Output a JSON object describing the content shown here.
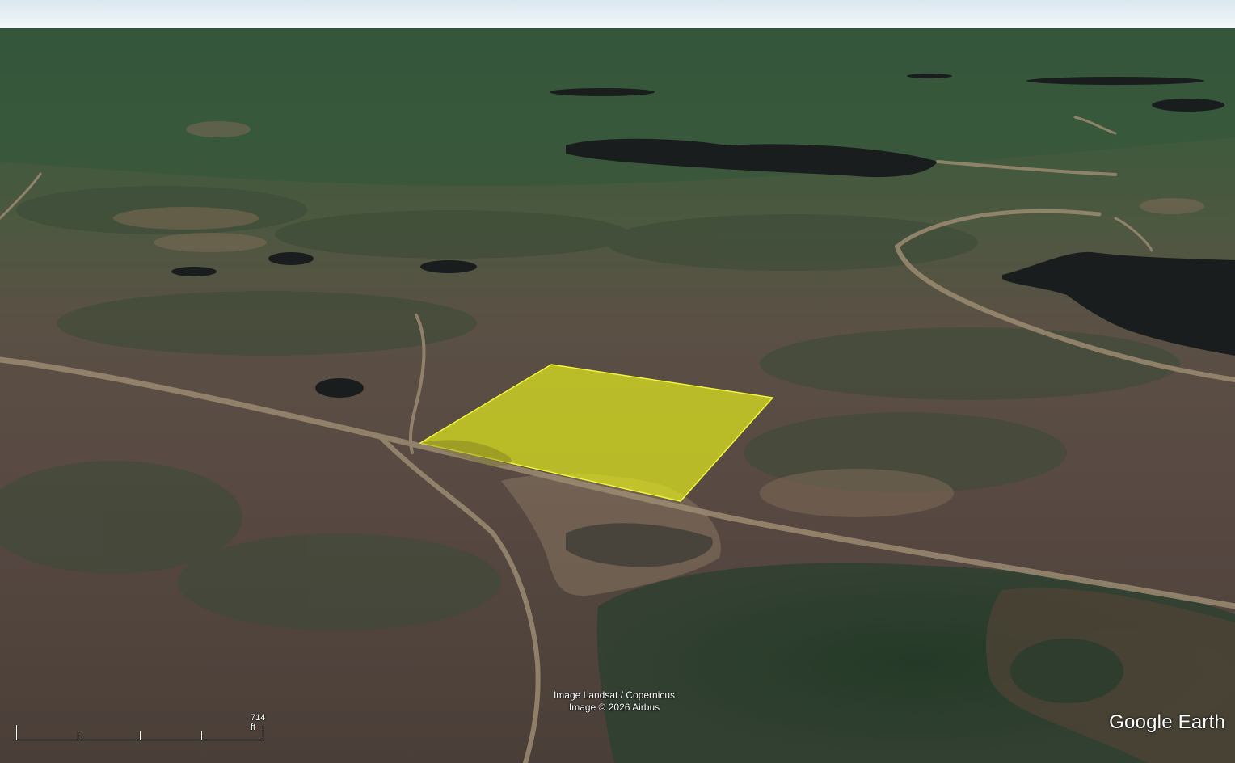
{
  "attribution": {
    "line1": "Image Landsat / Copernicus",
    "line2": "Image © 2026 Airbus"
  },
  "scale": {
    "label": "714 ft"
  },
  "logo": {
    "text": "Google Earth"
  },
  "colors": {
    "sky_top": "#dbe9f1",
    "sky_bottom": "#f4f8fa",
    "far_terrain": "#3c5a3b",
    "near_terrain": "#4e4237",
    "water": "#1a1d1f",
    "parcel_fill": "#e8f01a",
    "parcel_stroke": "#f5f540"
  }
}
